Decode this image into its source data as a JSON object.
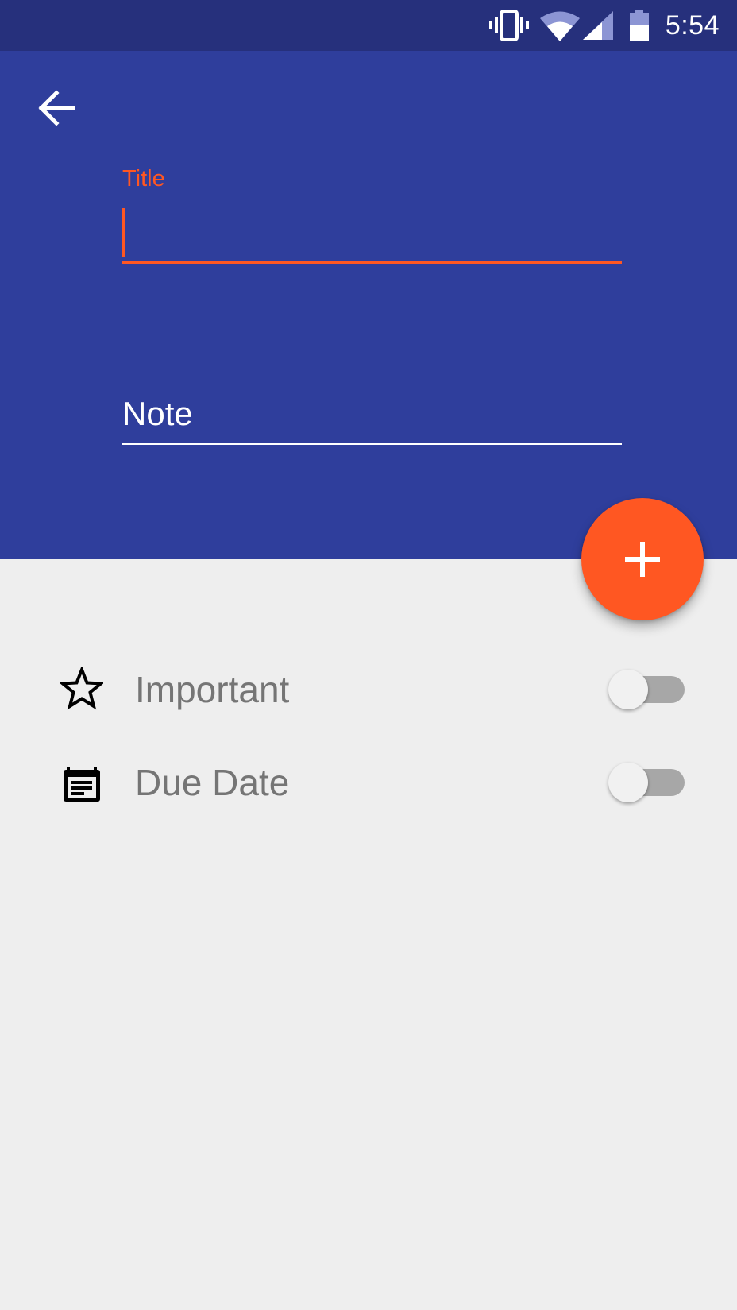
{
  "status_bar": {
    "time": "5:54",
    "icons": [
      "vibrate-icon",
      "wifi-icon",
      "cellular-signal-icon",
      "battery-icon"
    ]
  },
  "header": {
    "background_color": "#2f3e9c",
    "back_icon": "arrow-back-icon"
  },
  "form": {
    "title_label": "Title",
    "title_value": "",
    "note_placeholder": "Note",
    "accent_color": "#ff5722"
  },
  "fab": {
    "icon": "plus-icon",
    "color": "#ff5722"
  },
  "options": {
    "important": {
      "label": "Important",
      "icon": "star-outline-icon",
      "enabled": false
    },
    "due_date": {
      "label": "Due Date",
      "icon": "calendar-note-icon",
      "enabled": false
    }
  }
}
